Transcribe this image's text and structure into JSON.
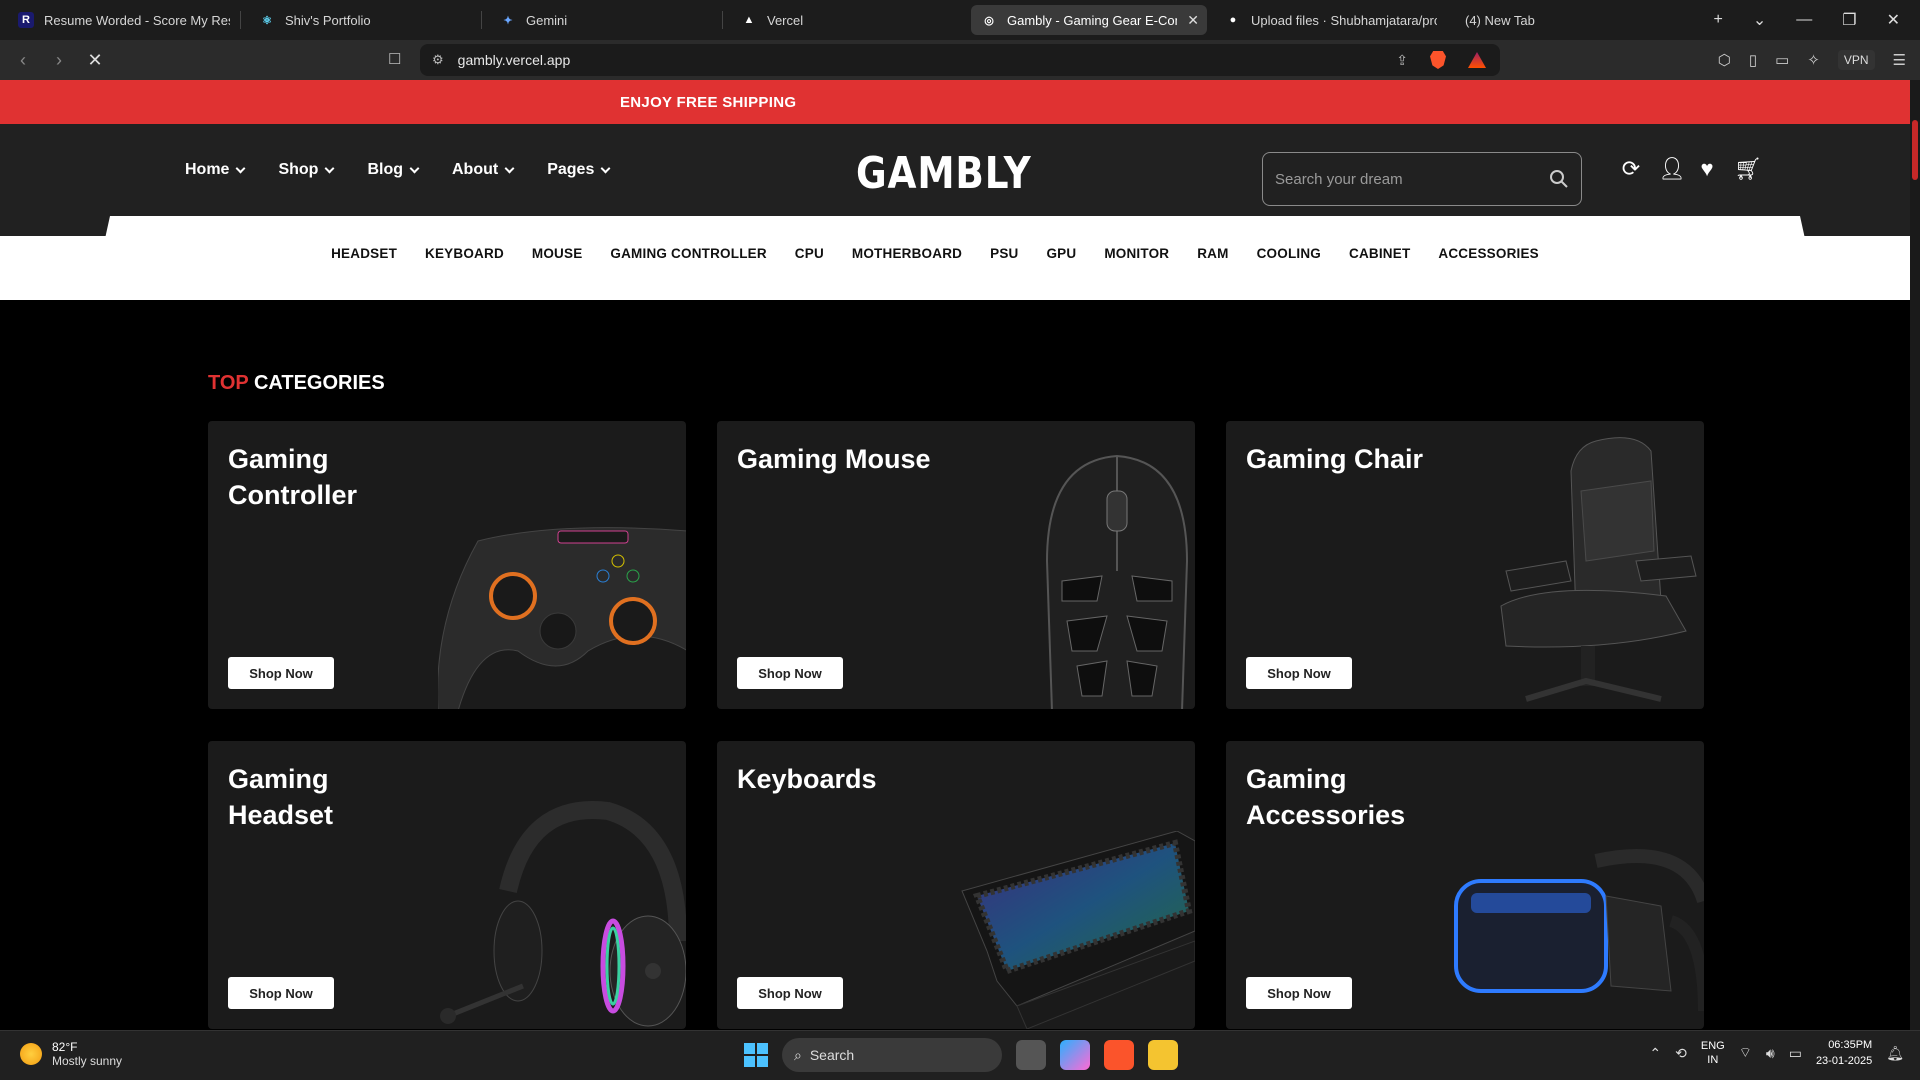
{
  "browser": {
    "tabs": [
      {
        "title": "Resume Worded - Score My Resume",
        "icon": "R",
        "color": "#1a1a6e"
      },
      {
        "title": "Shiv's Portfolio",
        "icon": "⚛",
        "color": "#2a3a4a"
      },
      {
        "title": "Gemini",
        "icon": "✦",
        "color": "#1c1c1c"
      },
      {
        "title": "Vercel",
        "icon": "▲",
        "color": "#1c1c1c"
      },
      {
        "title": "Gambly - Gaming Gear E-Commerce",
        "icon": "◎",
        "color": "#3a3a3a"
      },
      {
        "title": "Upload files · Shubhamjatara/project",
        "icon": "●",
        "color": "#1c1c1c"
      },
      {
        "title": "(4) New Tab",
        "icon": "",
        "color": "#1c1c1c"
      }
    ],
    "url": "gambly.vercel.app",
    "vpn_label": "VPN"
  },
  "site": {
    "promo": "ENJOY FREE SHIPPING",
    "nav": [
      "Home",
      "Shop",
      "Blog",
      "About",
      "Pages"
    ],
    "logo": "GAMBLY",
    "search_placeholder": "Search your dream",
    "categories": [
      "HEADSET",
      "KEYBOARD",
      "MOUSE",
      "GAMING CONTROLLER",
      "CPU",
      "MOTHERBOARD",
      "PSU",
      "GPU",
      "MONITOR",
      "RAM",
      "COOLING",
      "CABINET",
      "ACCESSORIES"
    ],
    "section_title_highlight": "TOP",
    "section_title_rest": "CATEGORIES",
    "cards": [
      {
        "title": "Gaming Controller",
        "button": "Shop Now"
      },
      {
        "title": "Gaming Mouse",
        "button": "Shop Now"
      },
      {
        "title": "Gaming Chair",
        "button": "Shop Now"
      },
      {
        "title": "Gaming Headset",
        "button": "Shop Now"
      },
      {
        "title": "Keyboards",
        "button": "Shop Now"
      },
      {
        "title": "Gaming Accessories",
        "button": "Shop Now"
      }
    ],
    "accent_color": "#e03232"
  },
  "taskbar": {
    "temp": "82°F",
    "weather": "Mostly sunny",
    "search_label": "Search",
    "lang_line1": "ENG",
    "lang_line2": "IN",
    "time": "06:35PM",
    "date": "23-01-2025"
  }
}
